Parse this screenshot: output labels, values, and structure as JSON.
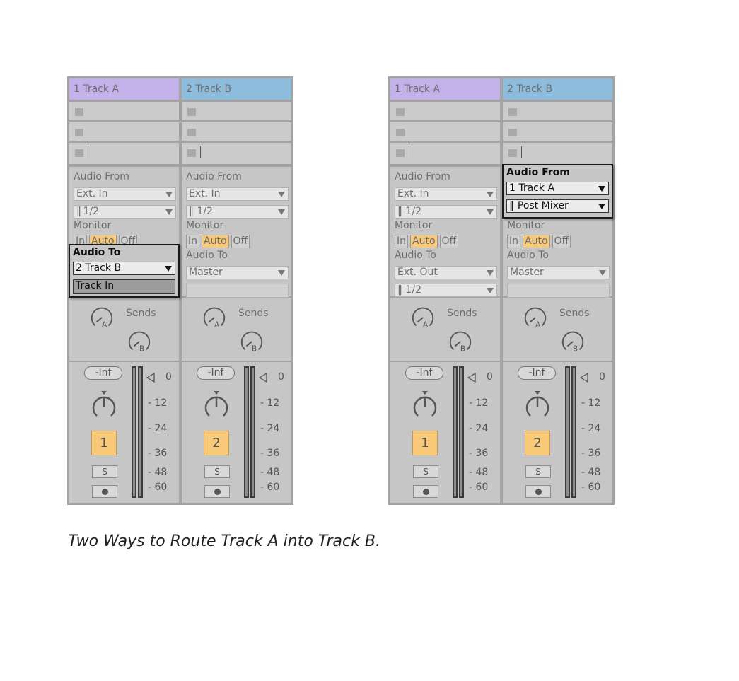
{
  "caption": "Two Ways to Route Track A into Track B.",
  "colors": {
    "track_a": "#c3b1ea",
    "track_b": "#8ebcdc",
    "active_orange": "#f8c978"
  },
  "panels": [
    {
      "tracks": [
        {
          "name": "1 Track A",
          "audio_from_label": "Audio From",
          "audio_from_value": "Ext. In",
          "channel_value": "1/2",
          "monitor_label": "Monitor",
          "monitor_options": [
            "In",
            "Auto",
            "Off"
          ],
          "monitor_selected": "Auto",
          "audio_to_label": "Audio To",
          "audio_to_value": "2 Track B",
          "audio_to_channel": "Track In",
          "sends_label": "Sends",
          "send_a": "A",
          "send_b": "B",
          "volume": "-Inf",
          "track_number": "1",
          "solo": "S",
          "meter_labels": [
            "0",
            "12",
            "24",
            "36",
            "48",
            "60"
          ]
        },
        {
          "name": "2 Track B",
          "audio_from_label": "Audio From",
          "audio_from_value": "Ext. In",
          "channel_value": "1/2",
          "monitor_label": "Monitor",
          "monitor_options": [
            "In",
            "Auto",
            "Off"
          ],
          "monitor_selected": "Auto",
          "audio_to_label": "Audio To",
          "audio_to_value": "Master",
          "audio_to_channel": "",
          "sends_label": "Sends",
          "send_a": "A",
          "send_b": "B",
          "volume": "-Inf",
          "track_number": "2",
          "solo": "S",
          "meter_labels": [
            "0",
            "12",
            "24",
            "36",
            "48",
            "60"
          ]
        }
      ]
    },
    {
      "tracks": [
        {
          "name": "1 Track A",
          "audio_from_label": "Audio From",
          "audio_from_value": "Ext. In",
          "channel_value": "1/2",
          "monitor_label": "Monitor",
          "monitor_options": [
            "In",
            "Auto",
            "Off"
          ],
          "monitor_selected": "Auto",
          "audio_to_label": "Audio To",
          "audio_to_value": "Ext. Out",
          "audio_to_channel": "1/2",
          "sends_label": "Sends",
          "send_a": "A",
          "send_b": "B",
          "volume": "-Inf",
          "track_number": "1",
          "solo": "S",
          "meter_labels": [
            "0",
            "12",
            "24",
            "36",
            "48",
            "60"
          ]
        },
        {
          "name": "2 Track B",
          "audio_from_label": "Audio From",
          "audio_from_value": "1 Track A",
          "channel_value": "Post Mixer",
          "monitor_label": "Monitor",
          "monitor_options": [
            "In",
            "Auto",
            "Off"
          ],
          "monitor_selected": "Auto",
          "audio_to_label": "Audio To",
          "audio_to_value": "Master",
          "audio_to_channel": "",
          "sends_label": "Sends",
          "send_a": "A",
          "send_b": "B",
          "volume": "-Inf",
          "track_number": "2",
          "solo": "S",
          "meter_labels": [
            "0",
            "12",
            "24",
            "36",
            "48",
            "60"
          ]
        }
      ]
    }
  ]
}
